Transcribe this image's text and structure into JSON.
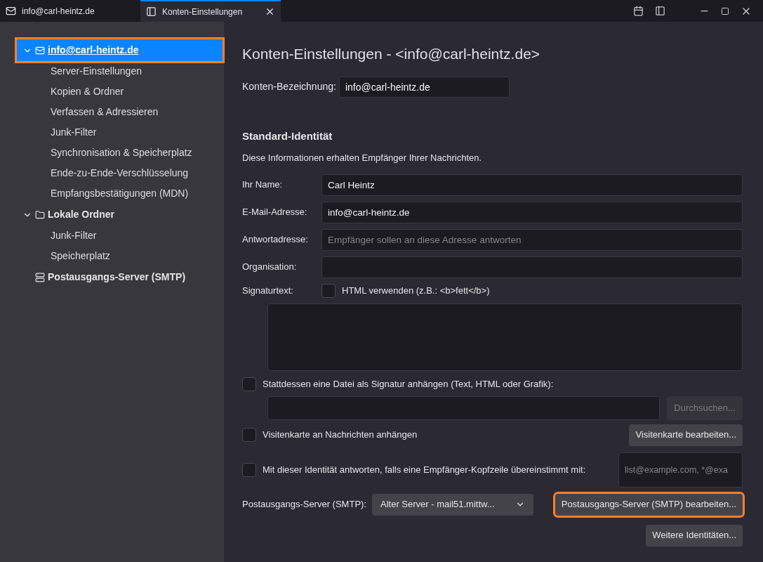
{
  "tabs": [
    {
      "label": "info@carl-heintz.de",
      "kind": "mail",
      "selected": false
    },
    {
      "label": "Konten-Einstellungen",
      "kind": "settings",
      "selected": true,
      "closable": true
    }
  ],
  "sidebar": {
    "items": [
      {
        "label": "info@carl-heintz.de",
        "kind": "account",
        "selected": true,
        "highlighted": true,
        "expanded": true,
        "children": [
          {
            "label": "Server-Einstellungen"
          },
          {
            "label": "Kopien & Ordner"
          },
          {
            "label": "Verfassen & Adressieren"
          },
          {
            "label": "Junk-Filter"
          },
          {
            "label": "Synchronisation & Speicherplatz"
          },
          {
            "label": "Ende-zu-Ende-Verschlüsselung"
          },
          {
            "label": "Empfangsbestätigungen (MDN)"
          }
        ]
      },
      {
        "label": "Lokale Ordner",
        "kind": "folder",
        "selected": false,
        "highlighted": false,
        "expanded": true,
        "children": [
          {
            "label": "Junk-Filter"
          },
          {
            "label": "Speicherplatz"
          }
        ]
      },
      {
        "label": "Postausgangs-Server (SMTP)",
        "kind": "smtp",
        "selected": false,
        "highlighted": false
      }
    ]
  },
  "page": {
    "title": "Konten-Einstellungen - <info@carl-heintz.de>",
    "account_name": {
      "label": "Konten-Bezeichnung:",
      "value": "info@carl-heintz.de"
    },
    "identity": {
      "heading": "Standard-Identität",
      "description": "Diese Informationen erhalten Empfänger Ihrer Nachrichten.",
      "fields": [
        {
          "label": "Ihr Name:",
          "value": "Carl Heintz"
        },
        {
          "label": "E-Mail-Adresse:",
          "value": "info@carl-heintz.de"
        },
        {
          "label": "Antwortadresse:",
          "placeholder": "Empfänger sollen an diese Adresse antworten"
        },
        {
          "label": "Organisation:"
        }
      ],
      "signature": {
        "label": "Signaturtext:",
        "html_checkbox": {
          "label": "HTML verwenden (z.B.: <b>fett</b>)",
          "checked": false
        }
      },
      "file_signature": {
        "label": "Stattdessen eine Datei als Signatur anhängen (Text, HTML oder Grafik):",
        "checked": false,
        "browse_button": {
          "label": "Durchsuchen...",
          "disabled": true
        }
      },
      "vcard": {
        "label": "Visitenkarte an Nachrichten anhängen",
        "checked": false,
        "button": "Visitenkarte bearbeiten..."
      },
      "reply_from": {
        "label": "Mit dieser Identität antworten, falls eine Empfänger-Kopfzeile übereinstimmt mit:",
        "checked": false,
        "placeholder": "list@example.com, *@exa"
      },
      "smtp": {
        "label": "Postausgangs-Server (SMTP):",
        "value": "Alter Server - mail51.mittw...",
        "button": {
          "label": "Postausgangs-Server (SMTP) bearbeiten...",
          "highlighted": true
        }
      },
      "more_button": "Weitere Identitäten..."
    }
  }
}
